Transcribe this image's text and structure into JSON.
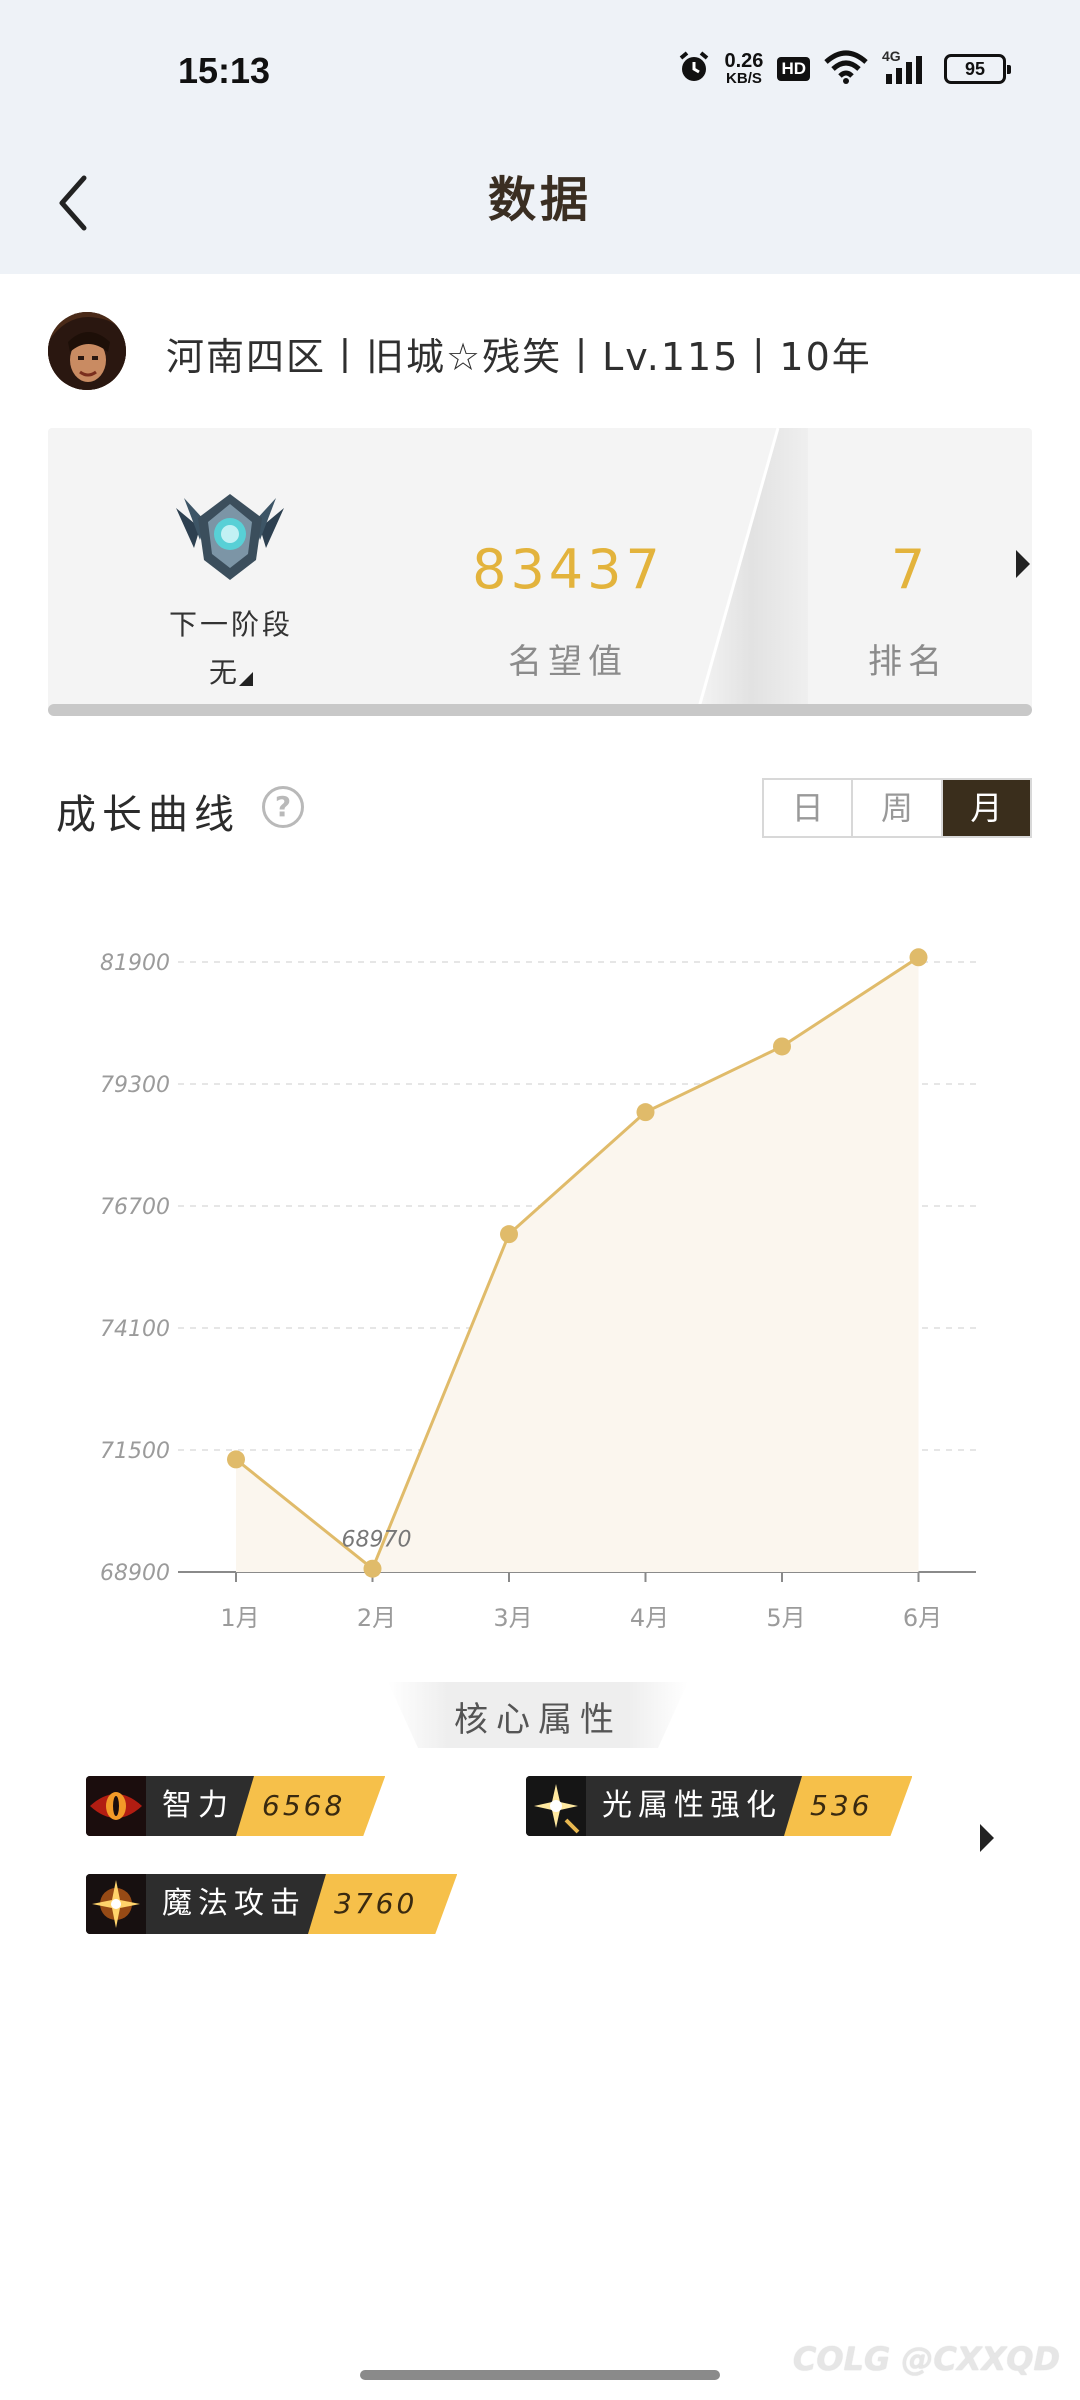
{
  "status_bar": {
    "time": "15:13",
    "net_speed_value": "0.26",
    "net_speed_unit": "KB/S",
    "hd": "HD",
    "signal": "4G",
    "battery": "95"
  },
  "nav": {
    "title": "数据"
  },
  "profile": {
    "name": "河南四区丨旧城☆残笑丨Lv.115丨10年"
  },
  "rank_card": {
    "next_stage_label": "下一阶段",
    "next_stage_value": "无",
    "fame_value": "83437",
    "fame_label": "名望值",
    "rank_value": "7",
    "rank_label": "排名"
  },
  "growth": {
    "title": "成长曲线",
    "help": "?",
    "tabs": [
      {
        "label": "日",
        "active": false
      },
      {
        "label": "周",
        "active": false
      },
      {
        "label": "月",
        "active": true
      }
    ]
  },
  "chart_data": {
    "type": "area",
    "categories": [
      "1月",
      "2月",
      "3月",
      "4月",
      "5月",
      "6月"
    ],
    "values": [
      71300,
      68970,
      76100,
      78700,
      80100,
      82000
    ],
    "ylim": [
      68900,
      81900
    ],
    "yticks": [
      "81900",
      "79300",
      "76700",
      "74100",
      "71500",
      "68900"
    ],
    "data_labels": [
      {
        "index": 1,
        "text": "68970"
      }
    ],
    "grid": true,
    "line_color": "#e0bb6a",
    "fill_color": "#fbf6ee"
  },
  "core_attributes": {
    "title": "核心属性",
    "items": [
      {
        "name": "智力",
        "value": "6568",
        "icon": "eye-icon"
      },
      {
        "name": "光属性强化",
        "value": "536",
        "icon": "light-spark-icon"
      },
      {
        "name": "魔法攻击",
        "value": "3760",
        "icon": "magic-star-icon"
      }
    ]
  },
  "watermark": "COLG @CXXQD",
  "colors": {
    "accent_gold": "#e3b33c",
    "active_tab": "#3a2e1c",
    "value_badge": "#f6c04a"
  }
}
